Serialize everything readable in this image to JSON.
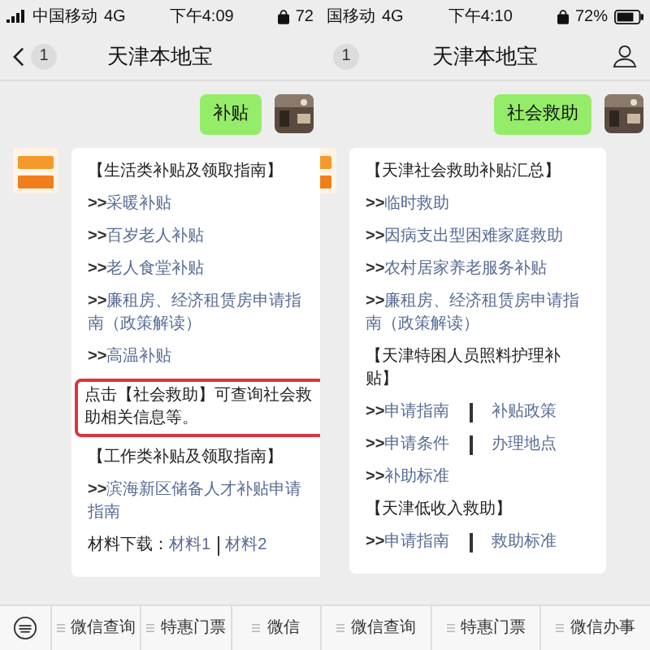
{
  "phones": [
    {
      "status": {
        "carrier": "中国移动",
        "network": "4G",
        "time": "下午4:09",
        "battery": "72"
      },
      "header": {
        "back": true,
        "badge": "1",
        "title": "天津本地宝",
        "profile": false
      },
      "user_message": "补贴",
      "bot_cut": false,
      "keyboard": true,
      "lines": [
        {
          "kind": "heading",
          "text": "【生活类补贴及领取指南】"
        },
        {
          "kind": "link",
          "prefix": ">>",
          "text": "采暖补贴"
        },
        {
          "kind": "link",
          "prefix": ">>",
          "text": "百岁老人补贴"
        },
        {
          "kind": "link",
          "prefix": ">>",
          "text": "老人食堂补贴"
        },
        {
          "kind": "link",
          "prefix": ">>",
          "text": "廉租房、经济租赁房申请指南（政策解读）"
        },
        {
          "kind": "link",
          "prefix": ">>",
          "text": "高温补贴"
        },
        {
          "kind": "notice",
          "text": "点击【社会救助】可查询社会救助相关信息等。"
        },
        {
          "kind": "heading",
          "text": "【工作类补贴及领取指南】"
        },
        {
          "kind": "link",
          "prefix": ">>",
          "text": "滨海新区储备人才补贴申请指南"
        },
        {
          "kind": "material",
          "prefix": "材料下载：",
          "links": [
            "材料1",
            "材料2"
          ]
        }
      ],
      "menu": [
        "微信查询",
        "特惠门票",
        "微信"
      ]
    },
    {
      "status": {
        "carrier": "国移动",
        "network": "4G",
        "time": "下午4:10",
        "battery": "72%"
      },
      "header": {
        "back": false,
        "badge": "1",
        "title": "天津本地宝",
        "profile": true
      },
      "user_message": "社会救助",
      "bot_cut": true,
      "keyboard": false,
      "lines": [
        {
          "kind": "heading",
          "text": "【天津社会救助补贴汇总】"
        },
        {
          "kind": "link",
          "prefix": ">>",
          "text": "临时救助"
        },
        {
          "kind": "link",
          "prefix": ">>",
          "text": "因病支出型困难家庭救助"
        },
        {
          "kind": "link",
          "prefix": ">>",
          "text": "农村居家养老服务补贴"
        },
        {
          "kind": "link",
          "prefix": ">>",
          "text": "廉租房、经济租赁房申请指南（政策解读）"
        },
        {
          "kind": "heading",
          "text": "【天津特困人员照料护理补贴】"
        },
        {
          "kind": "pair",
          "prefix": ">>",
          "links": [
            "申请指南",
            "补贴政策"
          ]
        },
        {
          "kind": "pair",
          "prefix": ">>",
          "links": [
            "申请条件",
            "办理地点"
          ]
        },
        {
          "kind": "link",
          "prefix": ">>",
          "text": "补助标准"
        },
        {
          "kind": "heading",
          "text": "【天津低收入救助】"
        },
        {
          "kind": "pair",
          "prefix": ">>",
          "links": [
            "申请指南",
            "救助标准"
          ]
        }
      ],
      "menu": [
        "微信查询",
        "特惠门票",
        "微信办事"
      ]
    }
  ]
}
